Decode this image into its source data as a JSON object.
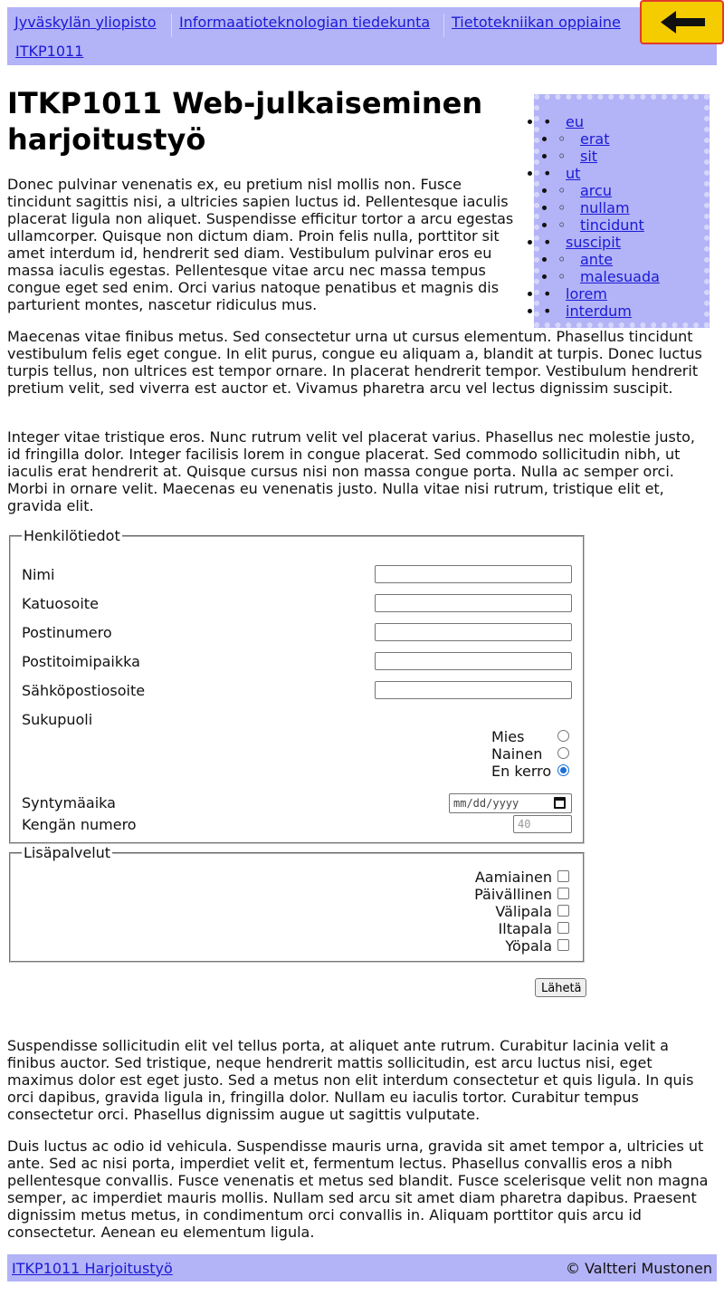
{
  "breadcrumbs": [
    {
      "label": "Jyväskylän yliopisto"
    },
    {
      "label": "Informaatioteknologian tiedekunta"
    },
    {
      "label": "Tietotekniikan oppiaine"
    },
    {
      "label": "ITKP1011"
    }
  ],
  "back_button": {
    "icon": "arrow-left-icon",
    "accent": "#f5cc00",
    "border": "#e23b2a"
  },
  "page_title": "ITKP1011 Web-julkaiseminen harjoitustyö",
  "toc": [
    {
      "label": "eu",
      "children": [
        {
          "label": "erat"
        },
        {
          "label": "sit"
        }
      ]
    },
    {
      "label": "ut",
      "children": [
        {
          "label": "arcu"
        },
        {
          "label": "nullam"
        },
        {
          "label": "tincidunt"
        }
      ]
    },
    {
      "label": "suscipit",
      "children": [
        {
          "label": "ante"
        },
        {
          "label": "malesuada"
        }
      ]
    },
    {
      "label": "lorem",
      "children": []
    },
    {
      "label": "interdum",
      "children": []
    }
  ],
  "paragraphs": [
    "Donec pulvinar venenatis ex, eu pretium nisl mollis non. Fusce tincidunt sagittis nisi, a ultricies sapien luctus id. Pellentesque iaculis placerat ligula non aliquet. Suspendisse efficitur tortor a arcu egestas ullamcorper. Quisque non dictum diam. Proin felis nulla, porttitor sit amet interdum id, hendrerit sed diam. Vestibulum pulvinar eros eu massa iaculis egestas. Pellentesque vitae arcu nec massa tempus congue eget sed enim. Orci varius natoque penatibus et magnis dis parturient montes, nascetur ridiculus mus.",
    "Maecenas vitae finibus metus. Sed consectetur urna ut cursus elementum. Phasellus tincidunt vestibulum felis eget congue. In elit purus, congue eu aliquam a, blandit at turpis. Donec luctus turpis tellus, non ultrices est tempor ornare. In placerat hendrerit tempor. Vestibulum hendrerit pretium velit, sed viverra est auctor et. Vivamus pharetra arcu vel lectus dignissim suscipit.",
    "Integer vitae tristique eros. Nunc rutrum velit vel placerat varius. Phasellus nec molestie justo, id fringilla dolor. Integer facilisis lorem in congue placerat. Sed commodo sollicitudin nibh, ut iaculis erat hendrerit at. Quisque cursus nisi non massa congue porta. Nulla ac semper orci. Morbi in ornare velit. Maecenas eu venenatis justo. Nulla vitae nisi rutrum, tristique elit et, gravida elit.",
    "Suspendisse sollicitudin elit vel tellus porta, at aliquet ante rutrum. Curabitur lacinia velit a finibus auctor. Sed tristique, neque hendrerit mattis sollicitudin, est arcu luctus nisi, eget maximus dolor est eget justo. Sed a metus non elit interdum consectetur et quis ligula. In quis orci dapibus, gravida ligula in, fringilla dolor. Nullam eu iaculis tortor. Curabitur tempus consectetur orci. Phasellus dignissim augue ut sagittis vulputate.",
    "Duis luctus ac odio id vehicula. Suspendisse mauris urna, gravida sit amet tempor a, ultricies ut ante. Sed ac nisi porta, imperdiet velit et, fermentum lectus. Phasellus convallis eros a nibh pellentesque convallis. Fusce venenatis et metus sed blandit. Fusce scelerisque velit non magna semper, ac imperdiet mauris mollis. Nullam sed arcu sit amet diam pharetra dapibus. Praesent dignissim metus metus, in condimentum orci convallis in. Aliquam porttitor quis arcu id consectetur. Aenean eu elementum ligula."
  ],
  "form": {
    "personal": {
      "legend": "Henkilötiedot",
      "fields": [
        {
          "label": "Nimi",
          "value": ""
        },
        {
          "label": "Katuosoite",
          "value": ""
        },
        {
          "label": "Postinumero",
          "value": ""
        },
        {
          "label": "Postitoimipaikka",
          "value": ""
        },
        {
          "label": "Sähköpostiosoite",
          "value": ""
        }
      ],
      "gender": {
        "label": "Sukupuoli",
        "options": [
          {
            "label": "Mies",
            "checked": false
          },
          {
            "label": "Nainen",
            "checked": false
          },
          {
            "label": "En kerro",
            "checked": true
          }
        ]
      },
      "birthdate": {
        "label": "Syntymäaika",
        "placeholder": "mm/dd/yyyy"
      },
      "shoe_size": {
        "label": "Kengän numero",
        "placeholder": "40"
      }
    },
    "extras": {
      "legend": "Lisäpalvelut",
      "options": [
        {
          "label": "Aamiainen",
          "checked": false
        },
        {
          "label": "Päivällinen",
          "checked": false
        },
        {
          "label": "Välipala",
          "checked": false
        },
        {
          "label": "Iltapala",
          "checked": false
        },
        {
          "label": "Yöpala",
          "checked": false
        }
      ]
    },
    "submit_label": "Lähetä"
  },
  "footer": {
    "link": "ITKP1011 Harjoitustyö",
    "copyright": "© Valtteri Mustonen"
  },
  "colors": {
    "nav_bg": "#b3b3f7",
    "link": "#1a1ad6",
    "radio_accent": "#1a6fd6"
  }
}
